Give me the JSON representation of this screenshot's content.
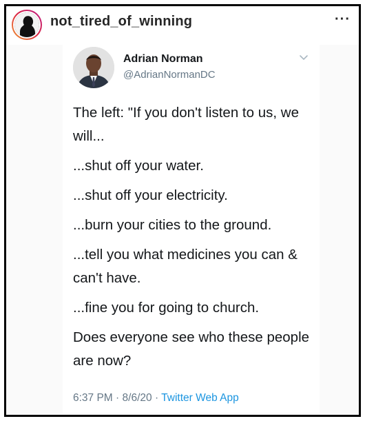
{
  "post": {
    "username": "not_tired_of_winning",
    "more_label": "···",
    "avatar_icon": "profile-silhouette-icon"
  },
  "tweet": {
    "author_name": "Adrian Norman",
    "author_handle": "@AdrianNormanDC",
    "avatar_icon": "author-photo",
    "menu_icon": "chevron-down-icon",
    "lines": [
      "The left: \"If you don't listen to us, we will...",
      "...shut off your water.",
      "...shut off your electricity.",
      "...burn your cities to the ground.",
      "...tell you what medicines you can & can't have.",
      "...fine you for going to church.",
      "Does everyone see who these people are now?"
    ],
    "time": "6:37 PM",
    "date": "8/6/20",
    "separator": "·",
    "source": "Twitter Web App"
  },
  "colors": {
    "text_primary": "#14171a",
    "text_secondary": "#657786",
    "link": "#1b95e0",
    "frame_border": "#000000"
  }
}
